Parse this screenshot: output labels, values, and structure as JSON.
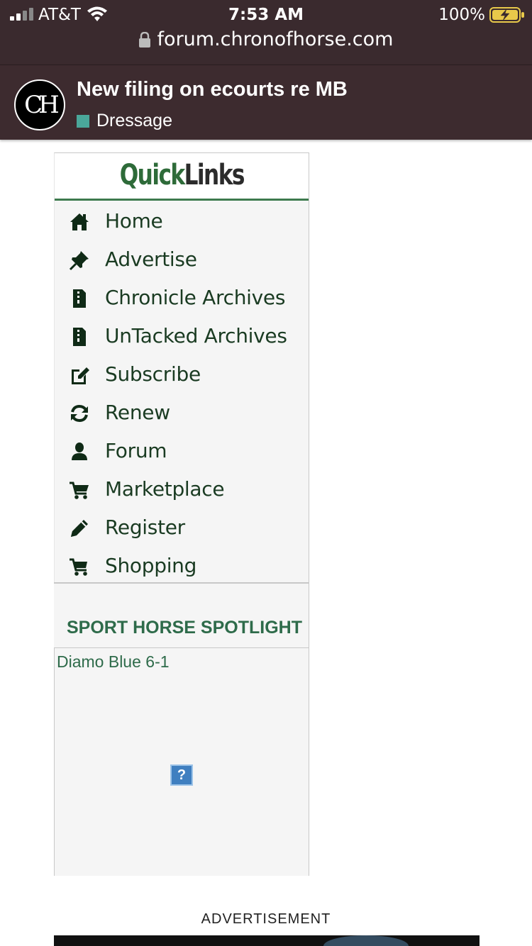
{
  "status_bar": {
    "carrier": "AT&T",
    "time": "7:53 AM",
    "battery": "100%"
  },
  "browser": {
    "url": "forum.chronofhorse.com"
  },
  "forum_header": {
    "logo_text": "CH",
    "thread_title": "New filing on ecourts re MB",
    "category": "Dressage",
    "category_color": "#4aa79a"
  },
  "quicklinks": {
    "title_part1": "Quick",
    "title_part2": "Links",
    "items": [
      {
        "label": "Home",
        "icon": "home-icon"
      },
      {
        "label": "Advertise",
        "icon": "pin-icon"
      },
      {
        "label": "Chronicle Archives",
        "icon": "archive-file-icon"
      },
      {
        "label": "UnTacked Archives",
        "icon": "archive-file-icon"
      },
      {
        "label": "Subscribe",
        "icon": "edit-icon"
      },
      {
        "label": "Renew",
        "icon": "refresh-icon"
      },
      {
        "label": "Forum",
        "icon": "user-icon"
      },
      {
        "label": "Marketplace",
        "icon": "cart-icon"
      },
      {
        "label": "Register",
        "icon": "pencil-icon"
      },
      {
        "label": "Shopping",
        "icon": "cart-icon"
      }
    ]
  },
  "spotlight": {
    "title": "SPORT HORSE SPOTLIGHT",
    "link_text": "Diamo Blue 6-1",
    "broken_image_glyph": "?"
  },
  "advertisement": {
    "label": "ADVERTISEMENT"
  },
  "colors": {
    "header_bg": "#3d2b2f",
    "accent_green": "#2e6b4a"
  }
}
